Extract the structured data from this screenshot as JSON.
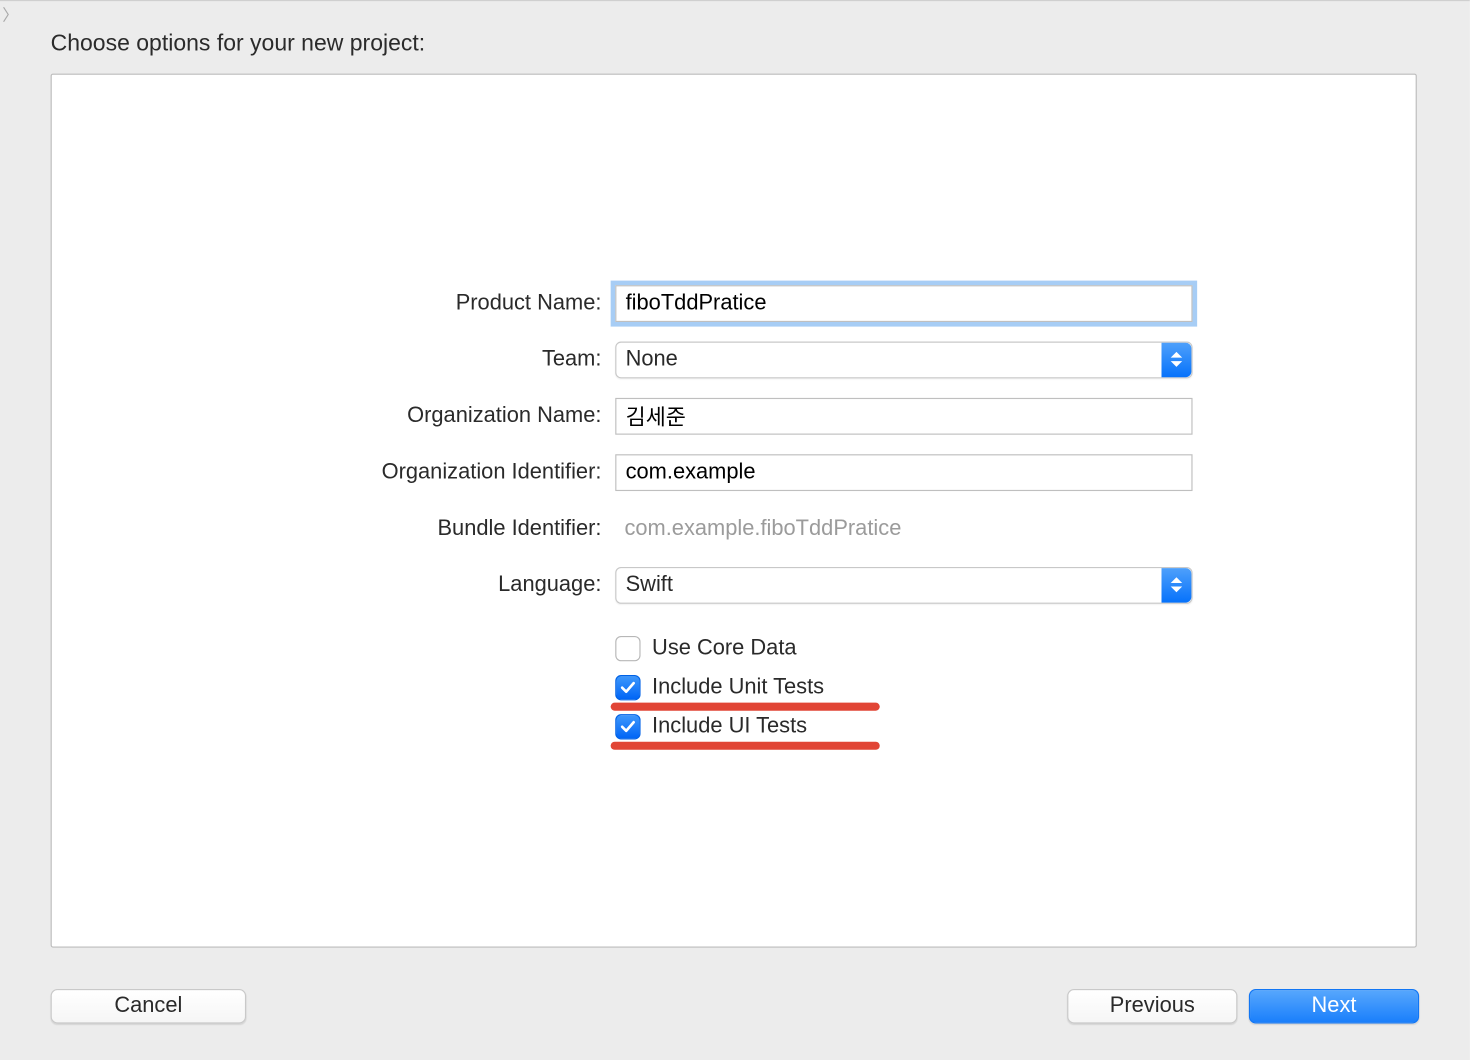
{
  "title": "Choose options for your new project:",
  "labels": {
    "product_name": "Product Name:",
    "team": "Team:",
    "organization_name": "Organization Name:",
    "organization_identifier": "Organization Identifier:",
    "bundle_identifier": "Bundle Identifier:",
    "language": "Language:"
  },
  "values": {
    "product_name": "fiboTddPratice",
    "team": "None",
    "organization_name": "김세준",
    "organization_identifier": "com.example",
    "bundle_identifier": "com.example.fiboTddPratice",
    "language": "Swift"
  },
  "checkboxes": {
    "use_core_data": {
      "label": "Use Core Data",
      "checked": false
    },
    "include_unit_tests": {
      "label": "Include Unit Tests",
      "checked": true
    },
    "include_ui_tests": {
      "label": "Include UI Tests",
      "checked": true
    }
  },
  "buttons": {
    "cancel": "Cancel",
    "previous": "Previous",
    "next": "Next"
  }
}
